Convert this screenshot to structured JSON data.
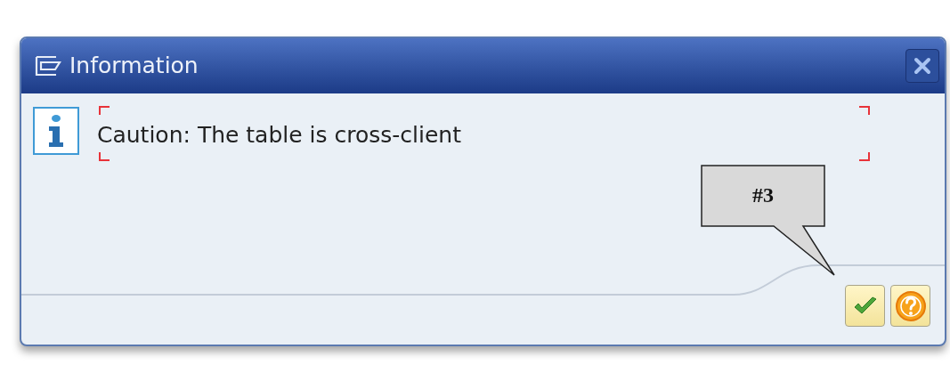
{
  "window": {
    "title": "Information"
  },
  "message": "Caution: The table is cross-client",
  "callout": {
    "label": "#3"
  },
  "buttons": [
    {
      "kind": "confirm"
    },
    {
      "kind": "help"
    }
  ]
}
